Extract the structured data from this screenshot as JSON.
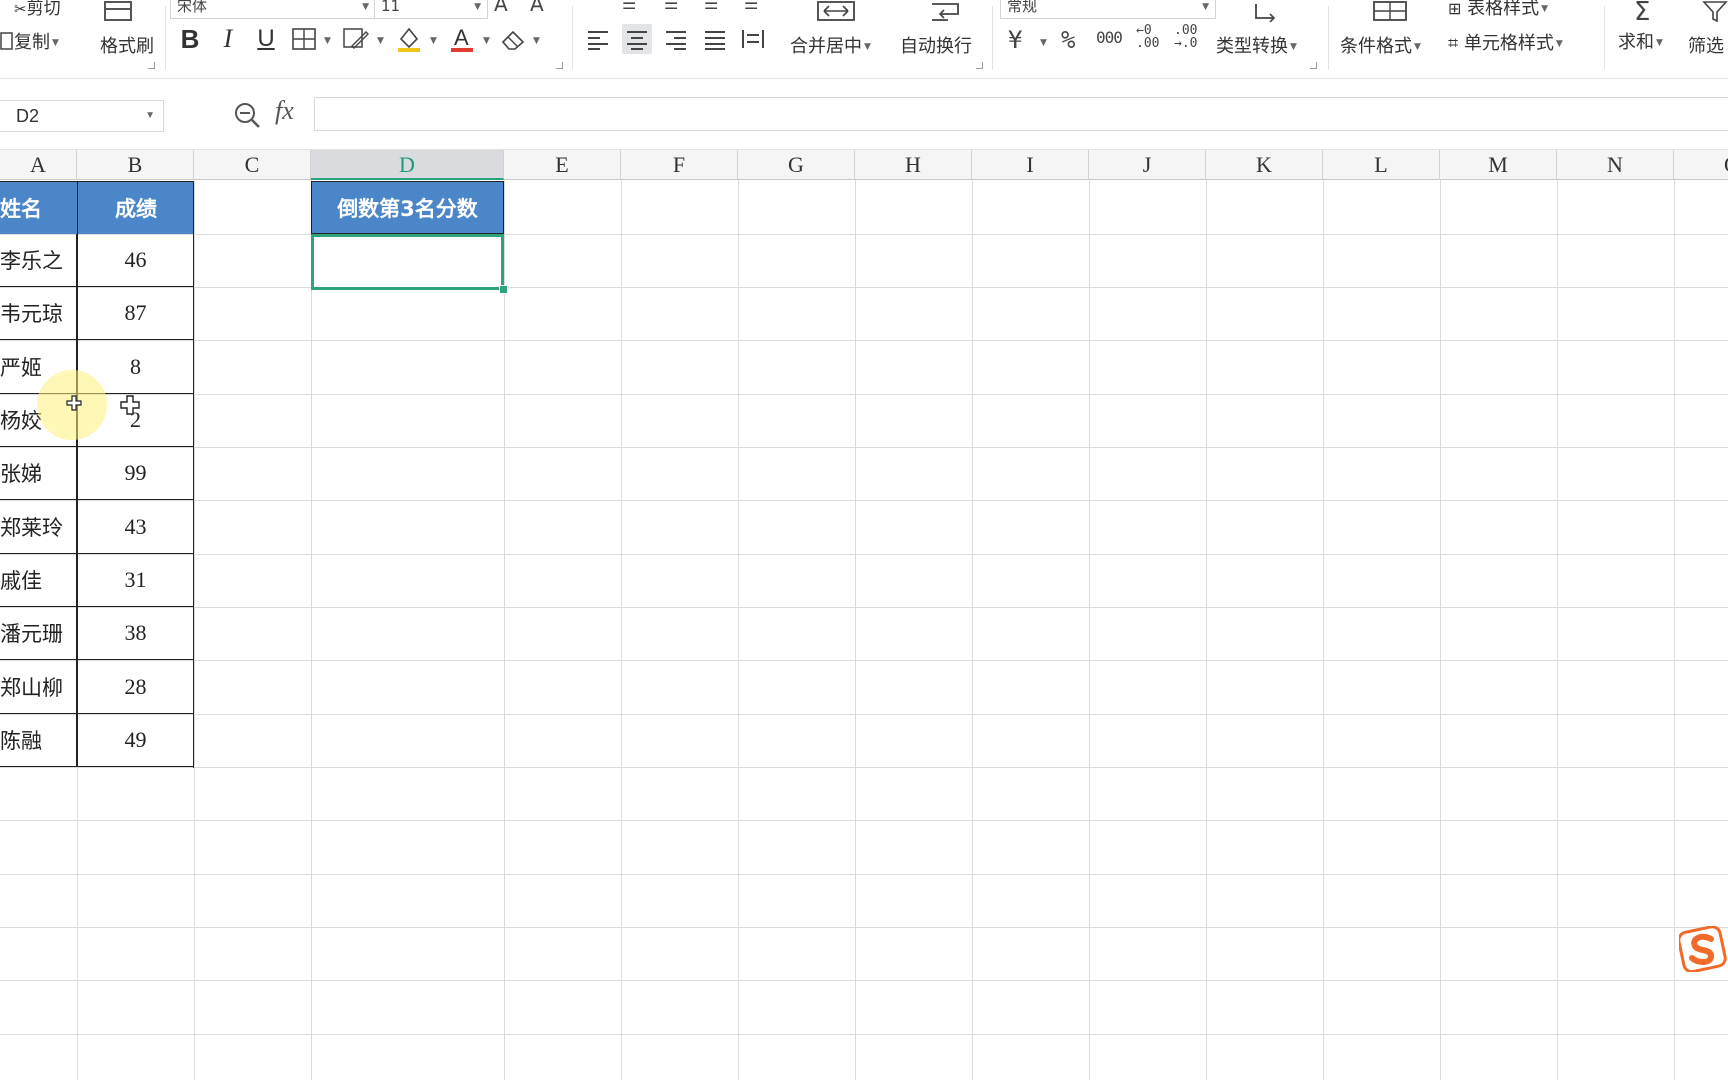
{
  "ribbon": {
    "cut": "剪切",
    "copy": "复制",
    "format_painter": "格式刷",
    "font_name": "宋体",
    "font_size": "11",
    "merge_center": "合并居中",
    "wrap_text": "自动换行",
    "number_format": "常规",
    "percent": "%",
    "thousands": "000",
    "type_convert": "类型转换",
    "conditional_format": "条件格式",
    "table_style": "表格样式",
    "cell_style": "单元格样式",
    "sum": "求和",
    "filter": "筛选",
    "currency": "¥"
  },
  "formula_bar": {
    "name_box": "D2",
    "fx": "fx",
    "formula": ""
  },
  "columns": [
    "A",
    "B",
    "C",
    "D",
    "E",
    "F",
    "G",
    "H",
    "I",
    "J",
    "K",
    "L",
    "M",
    "N",
    "O"
  ],
  "selected_column": "D",
  "table": {
    "header_name": "姓名",
    "header_score": "成绩",
    "rows": [
      {
        "name": "李乐之",
        "score": "46"
      },
      {
        "name": "韦元琼",
        "score": "87"
      },
      {
        "name": "严姬",
        "score": "8"
      },
      {
        "name": "杨姣",
        "score": "2"
      },
      {
        "name": "张娣",
        "score": "99"
      },
      {
        "name": "郑莱玲",
        "score": "43"
      },
      {
        "name": "戚佳",
        "score": "31"
      },
      {
        "name": "潘元珊",
        "score": "38"
      },
      {
        "name": "郑山柳",
        "score": "28"
      },
      {
        "name": "陈融",
        "score": "49"
      }
    ]
  },
  "d_header": "倒数第3名分数",
  "colors": {
    "header_blue": "#4a86c8",
    "selection_green": "#2fa27e",
    "sogou_orange": "#f26a2a"
  }
}
